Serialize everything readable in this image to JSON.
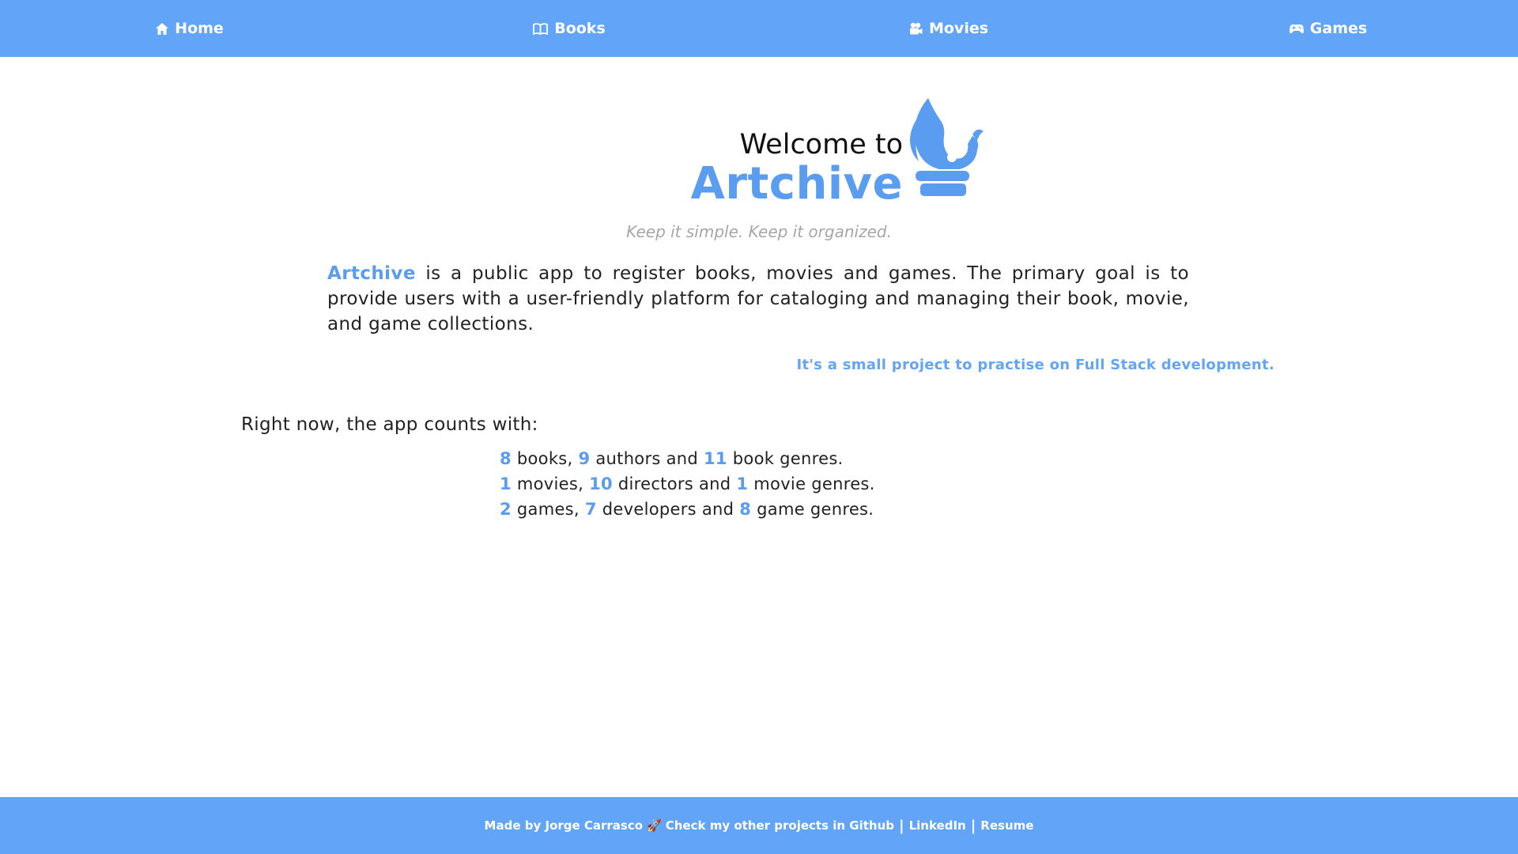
{
  "nav": {
    "items": [
      {
        "label": "Home",
        "icon": "home-icon"
      },
      {
        "label": "Books",
        "icon": "book-icon"
      },
      {
        "label": "Movies",
        "icon": "camera-icon"
      },
      {
        "label": "Games",
        "icon": "gamepad-icon"
      }
    ]
  },
  "hero": {
    "welcome": "Welcome to",
    "brand": "Artchive",
    "logo_icon": "artchive-logo-icon",
    "tagline": "Keep it simple. Keep it organized."
  },
  "description": {
    "brand": "Artchive",
    "text": " is a public app to register books, movies and games. The primary goal is to provide users with a user-friendly platform for cataloging and managing their book, movie, and game collections."
  },
  "project_note": "It's a small project to practise on Full Stack development.",
  "counts": {
    "intro": "Right now, the app counts with:",
    "books": {
      "count1": "8",
      "label1": " books, ",
      "count2": "9",
      "label2": " authors and ",
      "count3": "11",
      "label3": " book genres."
    },
    "movies": {
      "count1": "1",
      "label1": " movies, ",
      "count2": "10",
      "label2": " directors and ",
      "count3": "1",
      "label3": " movie genres."
    },
    "games": {
      "count1": "2",
      "label1": " games, ",
      "count2": "7",
      "label2": " developers and ",
      "count3": "8",
      "label3": " game genres."
    }
  },
  "footer": {
    "made_by": "Made by Jorge Carrasco",
    "rocket": "🚀",
    "github": "Check my other projects in Github",
    "separator": "|",
    "linkedin": "LinkedIn",
    "resume": "Resume"
  },
  "colors": {
    "accent": "#62a5f8",
    "brand": "#5a9cf0",
    "tagline": "#a6a6a6"
  }
}
